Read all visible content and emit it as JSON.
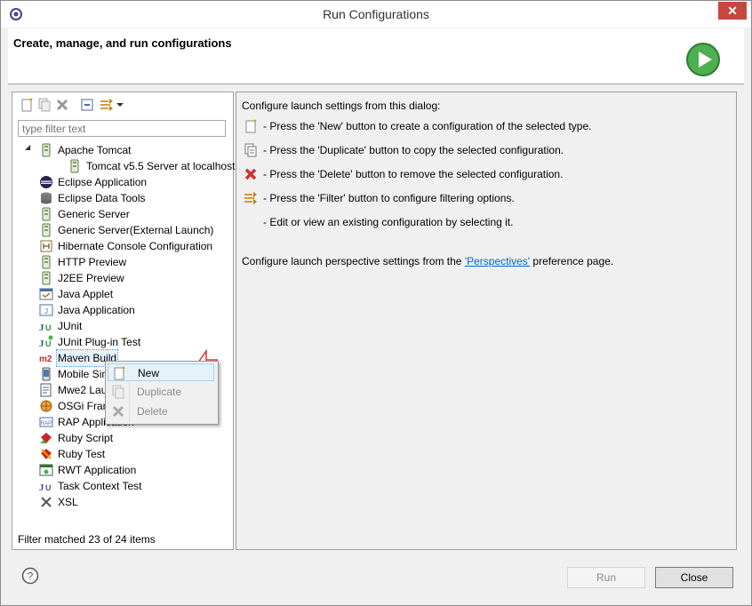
{
  "window": {
    "title": "Run Configurations",
    "close_glyph": "✕"
  },
  "header": {
    "text": "Create, manage, and run configurations"
  },
  "left": {
    "filter_placeholder": "type filter text",
    "tree": [
      {
        "label": "Apache Tomcat",
        "icon": "server-icon",
        "expanded": true,
        "level": 0
      },
      {
        "label": "Tomcat v5.5 Server at localhost",
        "icon": "server-icon",
        "level": 1
      },
      {
        "label": "Eclipse Application",
        "icon": "eclipse-icon",
        "level": 0
      },
      {
        "label": "Eclipse Data Tools",
        "icon": "database-icon",
        "level": 0
      },
      {
        "label": "Generic Server",
        "icon": "server-icon",
        "level": 0
      },
      {
        "label": "Generic Server(External Launch)",
        "icon": "server-icon",
        "level": 0
      },
      {
        "label": "Hibernate Console Configuration",
        "icon": "hibernate-icon",
        "level": 0
      },
      {
        "label": "HTTP Preview",
        "icon": "server-icon",
        "level": 0
      },
      {
        "label": "J2EE Preview",
        "icon": "server-icon",
        "level": 0
      },
      {
        "label": "Java Applet",
        "icon": "applet-icon",
        "level": 0
      },
      {
        "label": "Java Application",
        "icon": "java-app-icon",
        "level": 0
      },
      {
        "label": "JUnit",
        "icon": "junit-icon",
        "level": 0
      },
      {
        "label": "JUnit Plug-in Test",
        "icon": "junit-plugin-icon",
        "level": 0
      },
      {
        "label": "Maven Build",
        "icon": "maven-icon",
        "level": 0,
        "selected": true
      },
      {
        "label": "Mobile Sin",
        "icon": "mobile-icon",
        "level": 0
      },
      {
        "label": "Mwe2 Lau",
        "icon": "mwe2-icon",
        "level": 0
      },
      {
        "label": "OSGi Fram",
        "icon": "osgi-icon",
        "level": 0
      },
      {
        "label": "RAP Application",
        "icon": "rap-icon",
        "level": 0
      },
      {
        "label": "Ruby Script",
        "icon": "ruby-icon",
        "level": 0
      },
      {
        "label": "Ruby Test",
        "icon": "ruby-test-icon",
        "level": 0
      },
      {
        "label": "RWT Application",
        "icon": "rwt-icon",
        "level": 0
      },
      {
        "label": "Task Context Test",
        "icon": "task-icon",
        "level": 0
      },
      {
        "label": "XSL",
        "icon": "xsl-icon",
        "level": 0
      }
    ],
    "footer": "Filter matched 23 of 24 items"
  },
  "right": {
    "intro": "Configure launch settings from this dialog:",
    "items": [
      {
        "icon": "new-config-icon",
        "text": "- Press the 'New' button to create a configuration of the selected type."
      },
      {
        "icon": "duplicate-icon",
        "text": "- Press the 'Duplicate' button to copy the selected configuration."
      },
      {
        "icon": "delete-icon",
        "text": "- Press the 'Delete' button to remove the selected configuration."
      },
      {
        "icon": "filter-icon",
        "text": "- Press the 'Filter' button to configure filtering options."
      },
      {
        "icon": "",
        "text": "- Edit or view an existing configuration by selecting it."
      }
    ],
    "persp_before": "Configure launch perspective settings from the ",
    "persp_link": "'Perspectives'",
    "persp_after": " preference page."
  },
  "context_menu": {
    "new": "New",
    "duplicate": "Duplicate",
    "delete": "Delete"
  },
  "buttons": {
    "help": "?",
    "run": "Run",
    "close": "Close"
  }
}
